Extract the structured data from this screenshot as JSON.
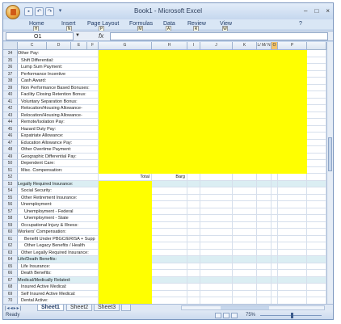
{
  "window": {
    "title": "Book1 - Microsoft Excel",
    "controls": [
      "–",
      "□",
      "×"
    ]
  },
  "ribbon": {
    "tabs": [
      {
        "label": "Home",
        "keytip": "H"
      },
      {
        "label": "Insert",
        "keytip": "N"
      },
      {
        "label": "Page Layout",
        "keytip": "P"
      },
      {
        "label": "Formulas",
        "keytip": "M"
      },
      {
        "label": "Data",
        "keytip": "A"
      },
      {
        "label": "Review",
        "keytip": "R"
      },
      {
        "label": "View",
        "keytip": "W"
      }
    ]
  },
  "formula_bar": {
    "name_box": "O1",
    "fx": "fx",
    "value": ""
  },
  "columns": [
    "C",
    "D",
    "E",
    "F",
    "G",
    "H",
    "I",
    "J",
    "K",
    "L/ M/ N",
    "O",
    "P"
  ],
  "rows": [
    {
      "num": "34",
      "text": "Other Pay:",
      "indent": 0,
      "yellow": "wide",
      "hl": false
    },
    {
      "num": "35",
      "text": "Shift Differential:",
      "indent": 1,
      "yellow": "wide",
      "hl": false
    },
    {
      "num": "36",
      "text": "Lump Sum Payment:",
      "indent": 1,
      "yellow": "wide",
      "hl": false
    },
    {
      "num": "37",
      "text": "Performance Incentive",
      "indent": 1,
      "yellow": "wide",
      "hl": false
    },
    {
      "num": "38",
      "text": "Cash Award:",
      "indent": 1,
      "yellow": "wide",
      "hl": false
    },
    {
      "num": "39",
      "text": "Non Performance Based Bonuses:",
      "indent": 1,
      "yellow": "wide",
      "hl": false
    },
    {
      "num": "40",
      "text": "Facility Closing Retention Bonus:",
      "indent": 1,
      "yellow": "wide",
      "hl": false
    },
    {
      "num": "41",
      "text": "Voluntary Separation Bonus:",
      "indent": 1,
      "yellow": "wide",
      "hl": false
    },
    {
      "num": "42",
      "text": "Relocation/Housing Allowance-",
      "indent": 1,
      "yellow": "wide",
      "hl": false
    },
    {
      "num": "43",
      "text": "Relocation/Housing Allowance-",
      "indent": 1,
      "yellow": "wide",
      "hl": false
    },
    {
      "num": "44",
      "text": "Remote/Isolation Pay:",
      "indent": 1,
      "yellow": "wide",
      "hl": false
    },
    {
      "num": "45",
      "text": "Hazard Duty Pay:",
      "indent": 1,
      "yellow": "wide",
      "hl": false
    },
    {
      "num": "46",
      "text": "Expatriate Allowance:",
      "indent": 1,
      "yellow": "wide",
      "hl": false
    },
    {
      "num": "47",
      "text": "Education Allowance Pay:",
      "indent": 1,
      "yellow": "wide",
      "hl": false
    },
    {
      "num": "48",
      "text": "Other Overtime Payment:",
      "indent": 1,
      "yellow": "wide",
      "hl": false
    },
    {
      "num": "49",
      "text": "Geographic Differential Pay:",
      "indent": 1,
      "yellow": "wide",
      "hl": false
    },
    {
      "num": "50",
      "text": "Dependent Care:",
      "indent": 1,
      "yellow": "wide",
      "hl": false
    },
    {
      "num": "51",
      "text": "Misc. Compensation:",
      "indent": 1,
      "yellow": "wide",
      "hl": false
    },
    {
      "num": "52",
      "text": "",
      "indent": 0,
      "yellow": "none",
      "hl": false,
      "g": "Total",
      "h": "Barg"
    },
    {
      "num": "53",
      "text": "Legally Required Insurance:",
      "indent": 0,
      "yellow": "narrow",
      "hl": true
    },
    {
      "num": "54",
      "text": "Social Security:",
      "indent": 1,
      "yellow": "narrow",
      "hl": false
    },
    {
      "num": "55",
      "text": "Other Retirement Insurance:",
      "indent": 1,
      "yellow": "narrow",
      "hl": false
    },
    {
      "num": "56",
      "text": "Unemployment:",
      "indent": 1,
      "yellow": "narrow",
      "hl": false
    },
    {
      "num": "57",
      "text": "Unemployment - Federal",
      "indent": 2,
      "yellow": "narrow",
      "hl": false
    },
    {
      "num": "58",
      "text": "Unemployment - State",
      "indent": 2,
      "yellow": "narrow",
      "hl": false
    },
    {
      "num": "59",
      "text": "Occupational Injury & Illness:",
      "indent": 1,
      "yellow": "narrow",
      "hl": false
    },
    {
      "num": "60",
      "text": "Workers' Compensation:",
      "indent": 0,
      "yellow": "narrow",
      "hl": false
    },
    {
      "num": "61",
      "text": "Benefit Under PBGC/ERISA + Supp",
      "indent": 2,
      "yellow": "narrow",
      "hl": false
    },
    {
      "num": "62",
      "text": "Other Legacy Benefits / Health",
      "indent": 2,
      "yellow": "narrow",
      "hl": false
    },
    {
      "num": "63",
      "text": "Other Legally Required Insurance:",
      "indent": 1,
      "yellow": "narrow",
      "hl": false
    },
    {
      "num": "64",
      "text": "Life/Death Benefits:",
      "indent": 0,
      "yellow": "narrow",
      "hl": true
    },
    {
      "num": "65",
      "text": "Life Insurance:",
      "indent": 1,
      "yellow": "narrow",
      "hl": false
    },
    {
      "num": "66",
      "text": "Death Benefits:",
      "indent": 1,
      "yellow": "narrow",
      "hl": false
    },
    {
      "num": "67",
      "text": "Medical/Medically Related:",
      "indent": 0,
      "yellow": "narrow",
      "hl": true
    },
    {
      "num": "68",
      "text": "Insured Active Medical:",
      "indent": 1,
      "yellow": "narrow",
      "hl": false
    },
    {
      "num": "69",
      "text": "Self Insured Active Medical:",
      "indent": 1,
      "yellow": "narrow",
      "hl": false
    },
    {
      "num": "70",
      "text": "Dental Active:",
      "indent": 1,
      "yellow": "narrow",
      "hl": false
    }
  ],
  "sheets": [
    "Sheet1",
    "Sheet2",
    "Sheet3"
  ],
  "status": {
    "ready": "Ready",
    "zoom": "75%"
  }
}
